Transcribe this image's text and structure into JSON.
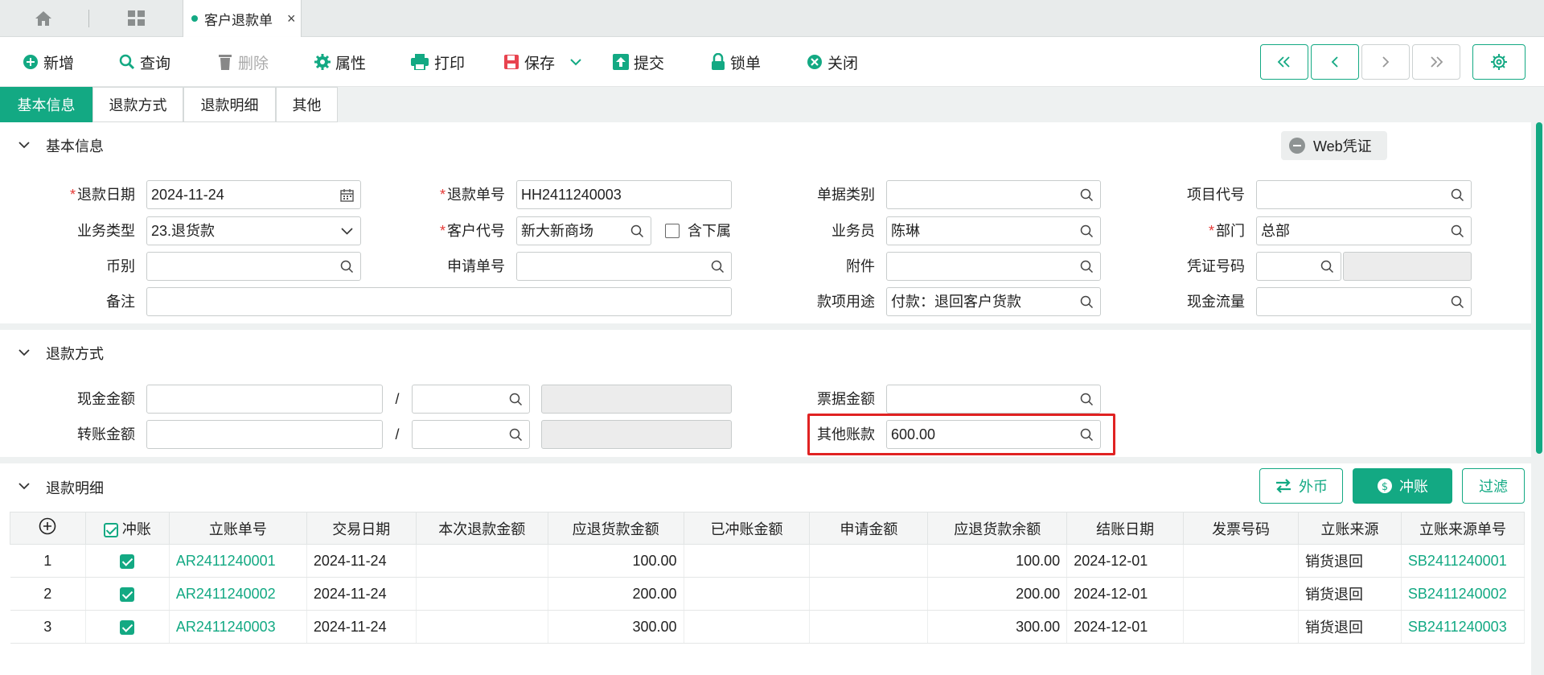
{
  "topbar": {
    "tab_title": "客户退款单",
    "tab_close": "×"
  },
  "toolbar": {
    "new": "新增",
    "query": "查询",
    "delete": "删除",
    "attrs": "属性",
    "print": "打印",
    "save": "保存",
    "submit": "提交",
    "lock": "锁单",
    "close": "关闭"
  },
  "form_tabs": [
    "基本信息",
    "退款方式",
    "退款明细",
    "其他"
  ],
  "basic": {
    "section_title": "基本信息",
    "web_voucher": "Web凭证",
    "refund_date_label": "退款日期",
    "refund_date": "2024-11-24",
    "refund_no_label": "退款单号",
    "refund_no": "HH2411240003",
    "doc_type_label": "单据类别",
    "doc_type": "",
    "project_code_label": "项目代号",
    "project_code": "",
    "biz_type_label": "业务类型",
    "biz_type": "23.退货款",
    "customer_code_label": "客户代号",
    "customer_code": "新大新商场",
    "include_sub_label": "含下属",
    "salesman_label": "业务员",
    "salesman": "陈琳",
    "dept_label": "部门",
    "dept": "总部",
    "currency_label": "币别",
    "currency": "",
    "apply_no_label": "申请单号",
    "apply_no": "",
    "attachment_label": "附件",
    "attachment": "",
    "voucher_no_label": "凭证号码",
    "voucher_no": "",
    "remark_label": "备注",
    "remark": "",
    "purpose_label": "款项用途",
    "purpose": "付款：退回客户货款",
    "cashflow_label": "现金流量",
    "cashflow": ""
  },
  "refund_method": {
    "section_title": "退款方式",
    "cash_label": "现金金额",
    "transfer_label": "转账金额",
    "slash": "/",
    "bill_label": "票据金额",
    "other_label": "其他账款",
    "other_value": "600.00"
  },
  "detail": {
    "section_title": "退款明细",
    "btn_foreign": "外币",
    "btn_offset": "冲账",
    "btn_filter": "过滤",
    "columns": [
      "冲账",
      "立账单号",
      "交易日期",
      "本次退款金额",
      "应退货款金额",
      "已冲账金额",
      "申请金额",
      "应退货款余额",
      "结账日期",
      "发票号码",
      "立账来源",
      "立账来源单号"
    ],
    "rows": [
      {
        "no": "1",
        "bill_no": "AR2411240001",
        "date": "2024-11-24",
        "this_refund": "",
        "due": "100.00",
        "offset": "",
        "apply": "",
        "balance": "100.00",
        "close_date": "2024-12-01",
        "invoice": "",
        "source": "销货退回",
        "source_no": "SB2411240001"
      },
      {
        "no": "2",
        "bill_no": "AR2411240002",
        "date": "2024-11-24",
        "this_refund": "",
        "due": "200.00",
        "offset": "",
        "apply": "",
        "balance": "200.00",
        "close_date": "2024-12-01",
        "invoice": "",
        "source": "销货退回",
        "source_no": "SB2411240002"
      },
      {
        "no": "3",
        "bill_no": "AR2411240003",
        "date": "2024-11-24",
        "this_refund": "",
        "due": "300.00",
        "offset": "",
        "apply": "",
        "balance": "300.00",
        "close_date": "2024-12-01",
        "invoice": "",
        "source": "销货退回",
        "source_no": "SB2411240003"
      }
    ]
  },
  "colors": {
    "accent": "#13a983",
    "required": "#e53935",
    "highlight": "#e02222"
  }
}
